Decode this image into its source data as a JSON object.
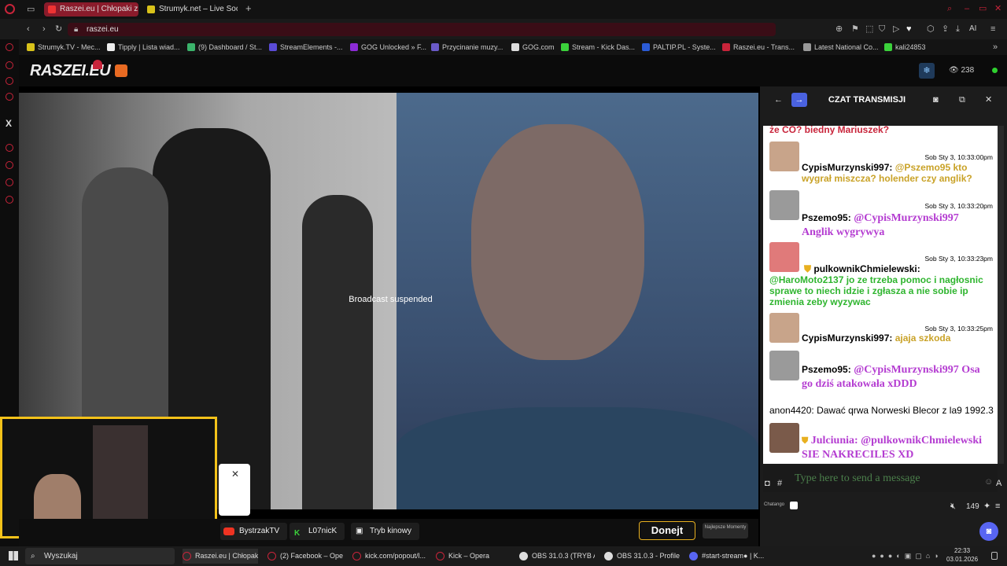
{
  "browser": {
    "tabs": [
      {
        "label": "Raszei.eu | Chłopaki z Ra",
        "active": true
      },
      {
        "label": "Strumyk.net – Live Soccer",
        "active": false
      }
    ],
    "url": "raszei.eu",
    "bookmarks": [
      "Strumyk.TV - Mec...",
      "Tipply | Lista wiad...",
      "(9) Dashboard / St...",
      "StreamElements -...",
      "GOG Unlocked » F...",
      "Przycinanie muzy...",
      "GOG.com",
      "Stream - Kick Das...",
      "PALTIP.PL - Syste...",
      "Raszei.eu - Trans...",
      "Latest National Co...",
      "kali24853"
    ],
    "ai_label": "AI"
  },
  "site": {
    "logo": "RASZEI.EU",
    "viewers": "238",
    "overlay_text": "Broadcast suspended",
    "buttons": {
      "bystrzak": "BystrzakTV",
      "l07nick": "L07nicK",
      "cinema": "Tryb kinowy",
      "donejt": "Donejt",
      "najlepsze": "Najlepsze Momenty"
    }
  },
  "chat": {
    "title": "CZAT TRANSMISJI",
    "cutoff_text": "że CO? biedny Mariuszek?",
    "messages": [
      {
        "time": "Sob Sty 3, 10:33:00pm",
        "user": "CypisMurzynski997:",
        "text": "@Pszemo95 kto wygrał miszcza? holender czy anglik?",
        "color": "#c9a227"
      },
      {
        "time": "Sob Sty 3, 10:33:20pm",
        "user": "Pszemo95:",
        "text": "@CypisMurzynski997 Anglik wygrywya",
        "color": "#b43cd1"
      },
      {
        "time": "Sob Sty 3, 10:33:23pm",
        "user": "pulkownikChmielewski:",
        "text": "@HaroMoto2137 jo ze trzeba pomoc i nagłosnic sprawe to niech idzie i zgłasza a nie sobie ip zmienia zeby wyzywac",
        "color": "#2fb52f"
      },
      {
        "time": "Sob Sty 3, 10:33:25pm",
        "user": "CypisMurzynski997:",
        "text": "ajaja szkoda",
        "color": "#c9a227"
      },
      {
        "time": "",
        "user": "Pszemo95:",
        "text": "@CypisMurzynski997 Osa go dziś atakowała xDDD",
        "color": "#b43cd1"
      },
      {
        "time": "",
        "user": "anon4420:",
        "text": "Dawać qrwa Norweski Blecor z la9 1992.3",
        "color": "#000000"
      },
      {
        "time": "",
        "user": "Julciunia:",
        "text": "@pulkownikChmielewski SIE NAKRECILES XD",
        "color": "#b43cd1"
      }
    ],
    "input_placeholder": "Type here to send a message",
    "footer_brand": "Chatango",
    "user_count": "149"
  },
  "taskbar": {
    "search": "Wyszukaj",
    "items": [
      "Raszei.eu | Chłopak...",
      "(2) Facebook – Opera",
      "kick.com/popout/l...",
      "Kick – Opera",
      "OBS 31.0.3 (TRYB A...",
      "OBS 31.0.3 - Profile:...",
      "#start-stream● | K..."
    ],
    "time": "22:33",
    "date": "03.01.2026"
  },
  "colors": {
    "accent": "#c8243a",
    "webcam_frame": "#f3c21a",
    "chat_bg": "#ffffff"
  }
}
